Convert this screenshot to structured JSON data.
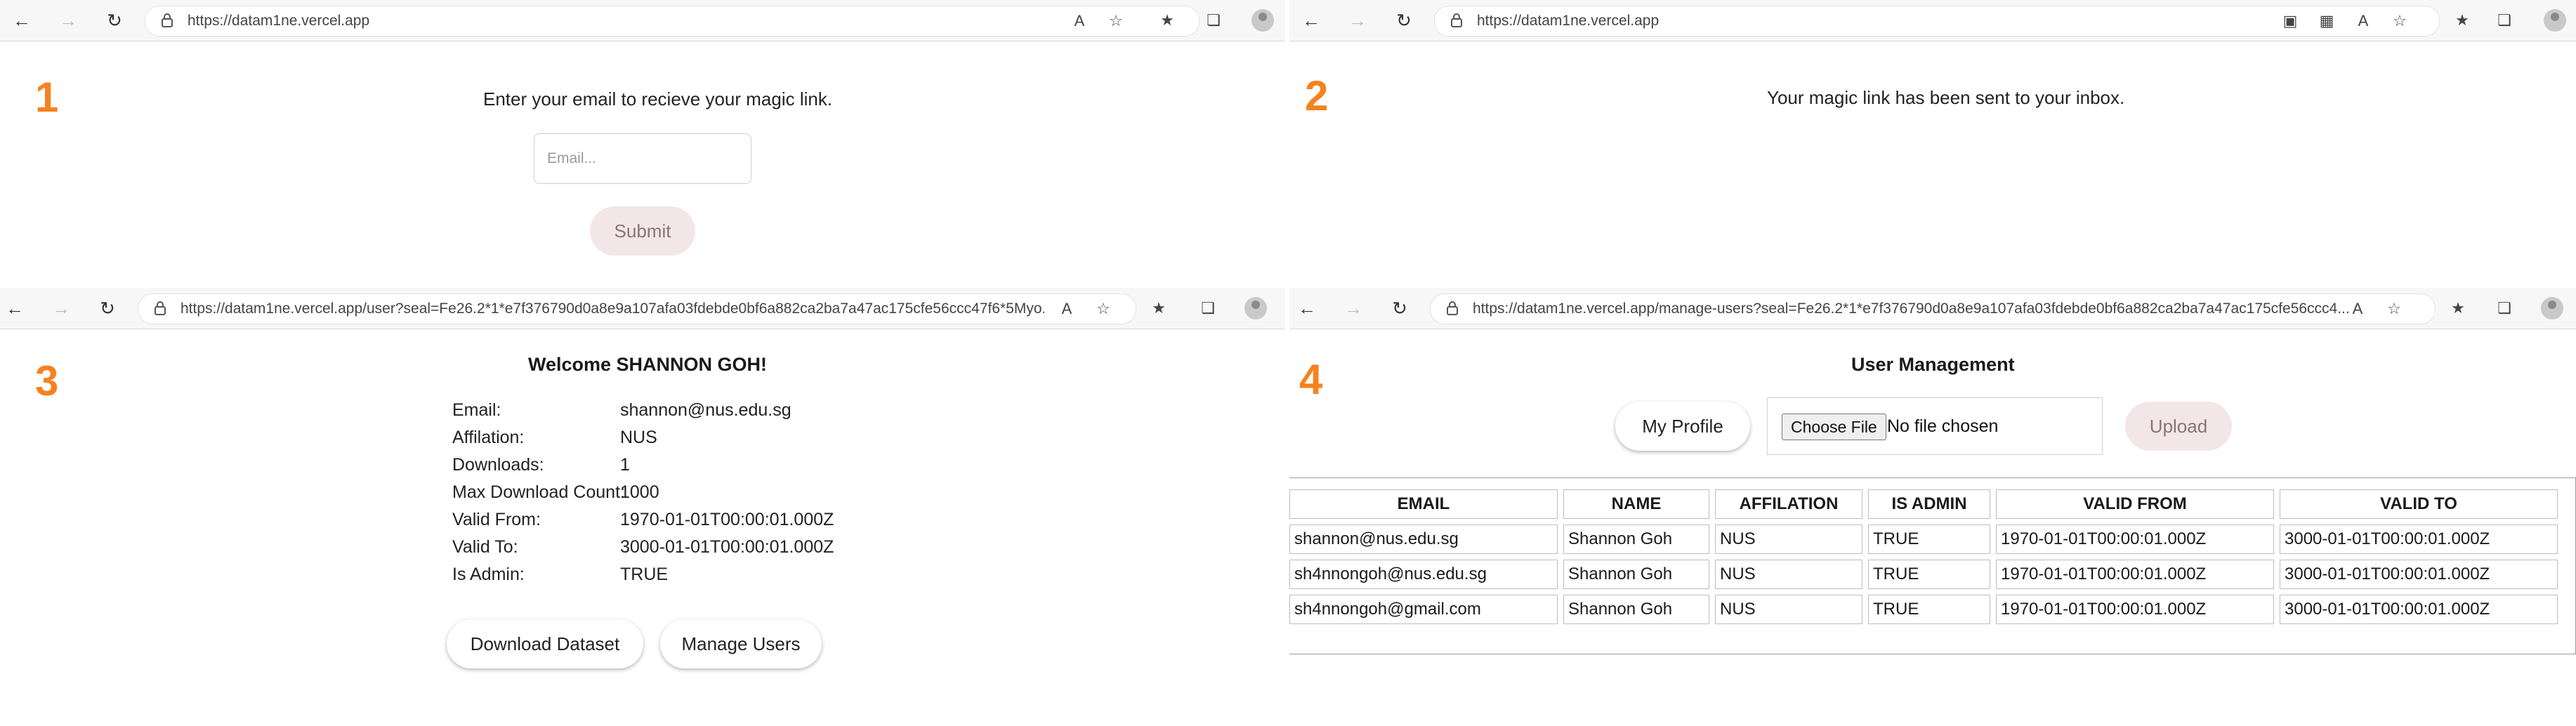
{
  "browser": {
    "panel1_url": "https://datam1ne.vercel.app",
    "panel2_url": "https://datam1ne.vercel.app",
    "panel3_url": "https://datam1ne.vercel.app/user?seal=Fe26.2*1*e7f376790d0a8e9a107afa03fdebde0bf6a882ca2ba7a47ac175cfe56ccc47f6*5Myo...",
    "panel4_url": "https://datam1ne.vercel.app/manage-users?seal=Fe26.2*1*e7f376790d0a8e9a107afa03fdebde0bf6a882ca2ba7a47ac175cfe56ccc4..."
  },
  "steps": {
    "one": "1",
    "two": "2",
    "three": "3",
    "four": "4"
  },
  "login": {
    "prompt": "Enter your email to recieve your magic link.",
    "email_placeholder": "Email...",
    "submit_label": "Submit"
  },
  "sent": {
    "message": "Your magic link has been sent to your inbox."
  },
  "profile": {
    "welcome": "Welcome SHANNON GOH!",
    "fields": [
      {
        "label": "Email:",
        "value": "shannon@nus.edu.sg"
      },
      {
        "label": "Affilation:",
        "value": "NUS"
      },
      {
        "label": "Downloads:",
        "value": "1"
      },
      {
        "label": "Max Download Count:",
        "value": "1000"
      },
      {
        "label": "Valid From:",
        "value": "1970-01-01T00:00:01.000Z"
      },
      {
        "label": "Valid To:",
        "value": "3000-01-01T00:00:01.000Z"
      },
      {
        "label": "Is Admin:",
        "value": "TRUE"
      }
    ],
    "download_label": "Download Dataset",
    "manage_label": "Manage Users"
  },
  "management": {
    "title": "User Management",
    "profile_label": "My Profile",
    "choose_file_label": "Choose File",
    "no_file_text": "No file chosen",
    "upload_label": "Upload",
    "columns": [
      "EMAIL",
      "NAME",
      "AFFILATION",
      "IS ADMIN",
      "VALID FROM",
      "VALID TO"
    ],
    "rows": [
      [
        "shannon@nus.edu.sg",
        "Shannon Goh",
        "NUS",
        "TRUE",
        "1970-01-01T00:00:01.000Z",
        "3000-01-01T00:00:01.000Z"
      ],
      [
        "sh4nnongoh@nus.edu.sg",
        "Shannon Goh",
        "NUS",
        "TRUE",
        "1970-01-01T00:00:01.000Z",
        "3000-01-01T00:00:01.000Z"
      ],
      [
        "sh4nnongoh@gmail.com",
        "Shannon Goh",
        "NUS",
        "TRUE",
        "1970-01-01T00:00:01.000Z",
        "3000-01-01T00:00:01.000Z"
      ]
    ]
  },
  "colors": {
    "step_number": "#f5821f",
    "light_button": "#f3e6e8"
  }
}
